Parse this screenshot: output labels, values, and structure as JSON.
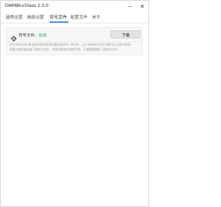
{
  "window": {
    "title": "DWMBlurGlass 2.3.0",
    "minimize_glyph": "—",
    "close_glyph": "✕"
  },
  "tabs": [
    {
      "label": "通用设置",
      "active": false
    },
    {
      "label": "高级设置",
      "active": false
    },
    {
      "label": "符号文件",
      "active": true
    },
    {
      "label": "配置文件",
      "active": false
    },
    {
      "label": "关于",
      "active": false
    }
  ],
  "symbols": {
    "icon": "gear-icon",
    "label": "符号文件:",
    "status": "有效",
    "status_color": "#2f9e44",
    "download_label": "下载",
    "description": [
      "符号文件(pdb)是由调试程序使用的编码程序的一种文件，这个有效符号文件可能可以立即对使用",
      "需要从微软服务器下载符号文件，如果您要本机使用PDB，可能需要重新下载新的文件。"
    ]
  },
  "accent_color": "#3a8ee6"
}
